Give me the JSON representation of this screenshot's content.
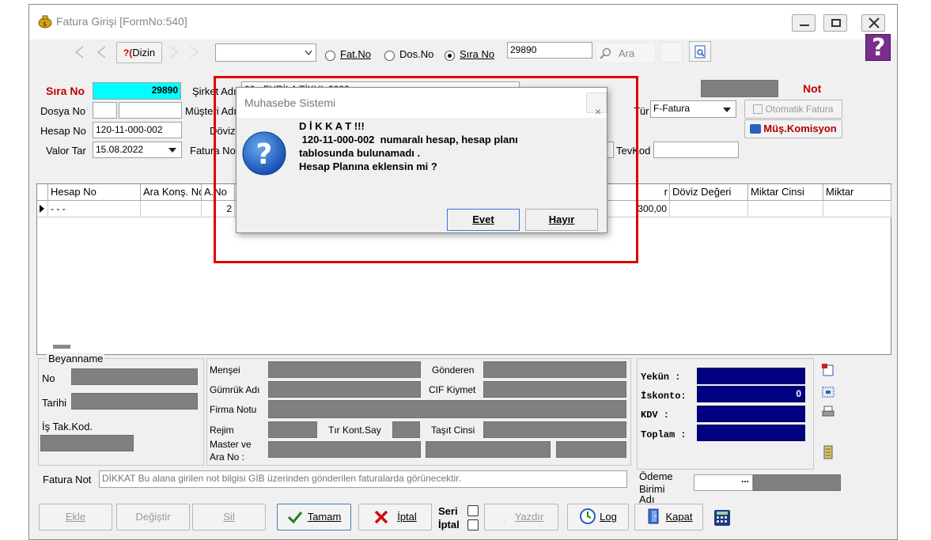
{
  "window": {
    "title": "Fatura Girişi [FormNo:540]"
  },
  "toolbar": {
    "dizin_label": "Dizin",
    "help_prefix": "?(",
    "radio_fatno": "Fat.No",
    "radio_dosno": "Dos.No",
    "radio_sirano": "Sıra No",
    "search_value": "29890",
    "ara_label": "Ara"
  },
  "header": {
    "sira_no_label": "Sıra No",
    "sira_no_value": "29890",
    "dosya_no_label": "Dosya No",
    "hesap_no_label": "Hesap No",
    "hesap_no_value": "120-11-000-002",
    "valor_tar_label": "Valor Tar",
    "valor_tar_value": "15.08.2022",
    "sirket_label": "Şirket Adı",
    "sirket_value": "00 - FURİLA TİKUL 2022",
    "musteri_label": "Müşteri Adı",
    "doviz_label": "Döviz",
    "fatura_no_label": "Fatura No",
    "not_label": "Not",
    "tur_label": "Tür",
    "tur_value": "F-Fatura",
    "otomatik_fatura": "Otomatik Fatura",
    "mus_komisyon": "Müş.Komisyon",
    "tevkod_label": "TevKod"
  },
  "grid": {
    "columns": [
      "Hesap No",
      "Ara Konş. No",
      "A.No",
      "r",
      "Döviz Değeri",
      "Miktar Cinsi",
      "Miktar"
    ],
    "row": {
      "hesap_no": "- - -",
      "a_no": "2",
      "tutar": "300,00"
    }
  },
  "beyanname": {
    "title": "Beyanname",
    "no_label": "No",
    "tarihi_label": "Tarihi",
    "is_tak_kod_label": "İş Tak.Kod."
  },
  "details": {
    "mensei": "Menşei",
    "gonderen": "Gönderen",
    "gumruk_adi": "Gümrük Adı",
    "cif_kiymet": "CIF Kiymet",
    "firma_notu": "Firma Notu",
    "rejim": "Rejim",
    "tir_kont_say": "Tır Kont.Say",
    "tasit_cinsi": "Taşıt Cinsi",
    "master_ve": "Master ve",
    "ara_no": "Ara No :"
  },
  "totals": {
    "yekun_label": "Yekün  :",
    "iskonto_label": "İskonto:",
    "iskonto_value": "0",
    "kdv_label": "KDV    :",
    "toplam_label": "Toplam :"
  },
  "fatura_not": {
    "label": "Fatura Not",
    "value": "DİKKAT Bu alana girilen not bilgisi GİB üzerinden gönderilen faturalarda görünecektir."
  },
  "odeme": {
    "line1": "Ödeme",
    "line2": "Birimi",
    "line3": "Adı",
    "ellipsis": "..."
  },
  "buttons": {
    "ekle": "Ekle",
    "degistir": "Değiştir",
    "sil": "Sil",
    "tamam": "Tamam",
    "iptal": "İptal",
    "seri": "Seri",
    "seri_iptal": "İptal",
    "yazdir": "Yazdır",
    "log": "Log",
    "kapat": "Kapat"
  },
  "dialog": {
    "title": "Muhasebe Sistemi",
    "close": "×",
    "message_line1": "D İ K K A T !!!",
    "message_line2": " 120-11-000-002  numaralı hesap, hesap planı",
    "message_line3": "tablosunda bulunamadı .",
    "message_line4": "Hesap Planına eklensin mi ?",
    "evet": "Evet",
    "hayir": "Hayır"
  },
  "colors": {
    "accent_cyan": "#00ffff",
    "total_navy": "#000080",
    "highlight_red": "#e00000",
    "label_red": "#c00000"
  }
}
